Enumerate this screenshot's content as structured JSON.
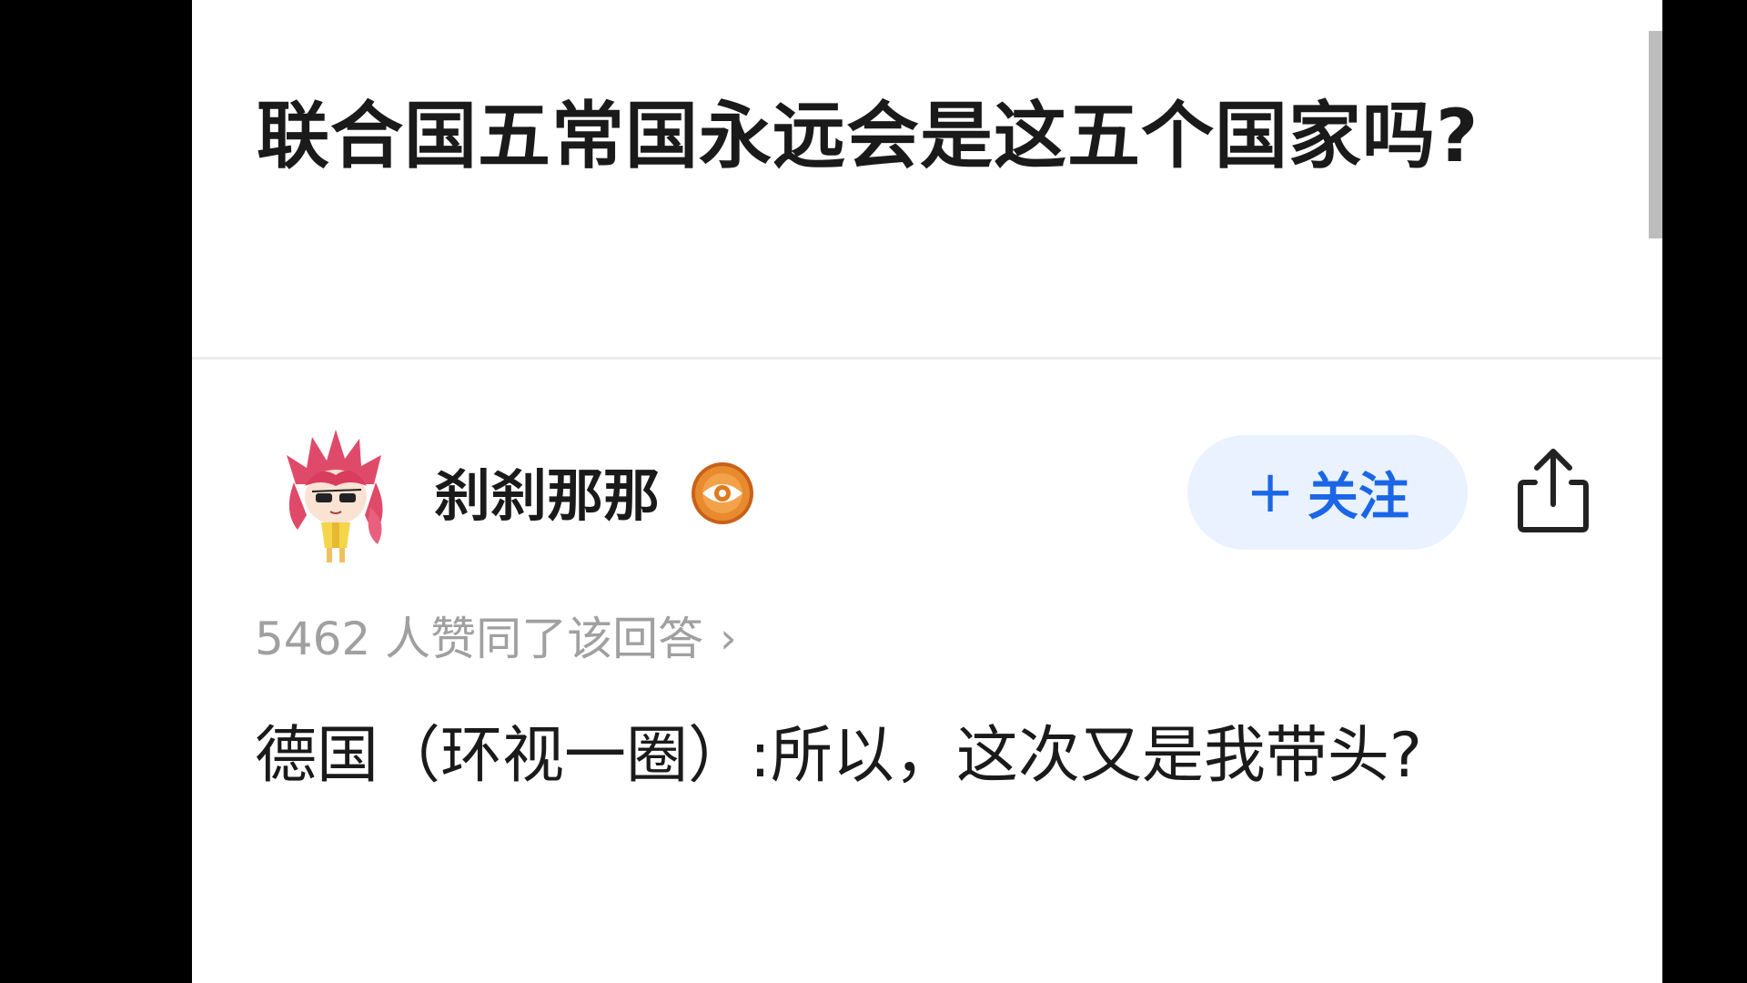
{
  "question": {
    "title": "联合国五常国永远会是这五个国家吗?"
  },
  "author": {
    "name": "刹刹那那",
    "avatar_icon": "anime-avatar-icon",
    "badge_icon": "eye-badge-icon",
    "badge_color": "#e07a1f"
  },
  "actions": {
    "follow_plus": "+",
    "follow_label": "关注",
    "share_icon": "share-icon"
  },
  "answer": {
    "upvote_text": "5462 人赞同了该回答",
    "upvote_chevron": "›",
    "content": "德国（环视一圈）:所以，这次又是我带头?"
  },
  "colors": {
    "accent": "#1a66e6",
    "follow_bg": "#eaf2ff",
    "text_primary": "#1a1a1a",
    "text_secondary": "#a0a0a0"
  }
}
